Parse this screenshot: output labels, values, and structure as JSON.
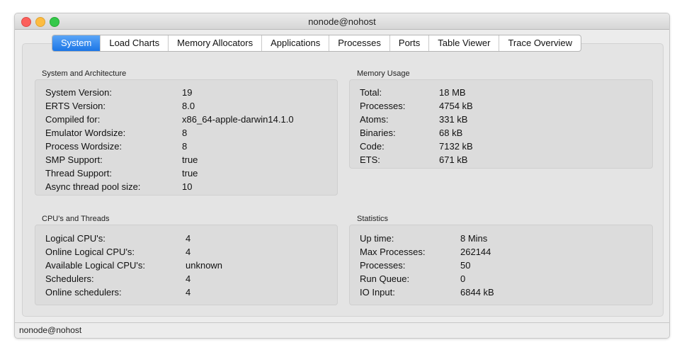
{
  "window": {
    "title": "nonode@nohost"
  },
  "tabs": [
    "System",
    "Load Charts",
    "Memory Allocators",
    "Applications",
    "Processes",
    "Ports",
    "Table Viewer",
    "Trace Overview"
  ],
  "active_tab": "System",
  "sections": {
    "system": {
      "title": "System and Architecture",
      "rows": [
        {
          "label": "System Version:",
          "value": "19"
        },
        {
          "label": "ERTS Version:",
          "value": "8.0"
        },
        {
          "label": "Compiled for:",
          "value": "x86_64-apple-darwin14.1.0"
        },
        {
          "label": "Emulator Wordsize:",
          "value": "8"
        },
        {
          "label": "Process Wordsize:",
          "value": "8"
        },
        {
          "label": "SMP Support:",
          "value": "true"
        },
        {
          "label": "Thread Support:",
          "value": "true"
        },
        {
          "label": "Async thread pool size:",
          "value": "10"
        }
      ]
    },
    "memory": {
      "title": "Memory Usage",
      "rows": [
        {
          "label": "Total:",
          "value": "18 MB"
        },
        {
          "label": "Processes:",
          "value": "4754 kB"
        },
        {
          "label": "Atoms:",
          "value": "331 kB"
        },
        {
          "label": "Binaries:",
          "value": "68 kB"
        },
        {
          "label": "Code:",
          "value": "7132 kB"
        },
        {
          "label": "ETS:",
          "value": "671 kB"
        }
      ]
    },
    "cpu": {
      "title": "CPU's and Threads",
      "rows": [
        {
          "label": "Logical CPU's:",
          "value": "4"
        },
        {
          "label": "Online Logical CPU's:",
          "value": "4"
        },
        {
          "label": "Available Logical CPU's:",
          "value": "unknown"
        },
        {
          "label": "Schedulers:",
          "value": "4"
        },
        {
          "label": "Online schedulers:",
          "value": "4"
        }
      ]
    },
    "statistics": {
      "title": "Statistics",
      "rows": [
        {
          "label": "Up time:",
          "value": "8 Mins"
        },
        {
          "label": "Max Processes:",
          "value": "262144"
        },
        {
          "label": "Processes:",
          "value": "50"
        },
        {
          "label": "Run Queue:",
          "value": "0"
        },
        {
          "label": "IO Input:",
          "value": "6844 kB"
        }
      ]
    }
  },
  "status_bar": {
    "text": "nonode@nohost"
  },
  "colors": {
    "active_tab": "#1c76e6",
    "close": "#fc605c",
    "minimize": "#fdbc40",
    "maximize": "#34c84a"
  }
}
